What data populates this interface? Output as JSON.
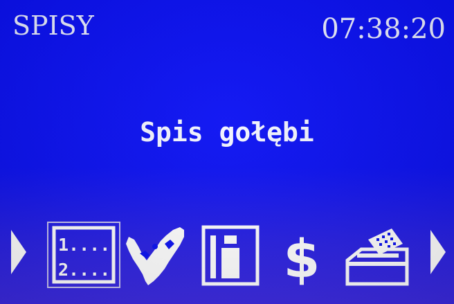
{
  "header": {
    "title": "SPISY",
    "clock": "07:38:20"
  },
  "main": {
    "selected_label": "Spis gołębi"
  },
  "toolbar": {
    "items": [
      {
        "icon": "numbered-list-icon",
        "glyph_lines": [
          "1....",
          "2...."
        ]
      },
      {
        "icon": "pigeon-icon"
      },
      {
        "icon": "info-icon"
      },
      {
        "icon": "dollar-icon",
        "glyph": "$"
      },
      {
        "icon": "printer-icon"
      }
    ],
    "selected_index": 0
  },
  "colors": {
    "background": "#0c12f2",
    "foreground": "#f2f4ff"
  }
}
